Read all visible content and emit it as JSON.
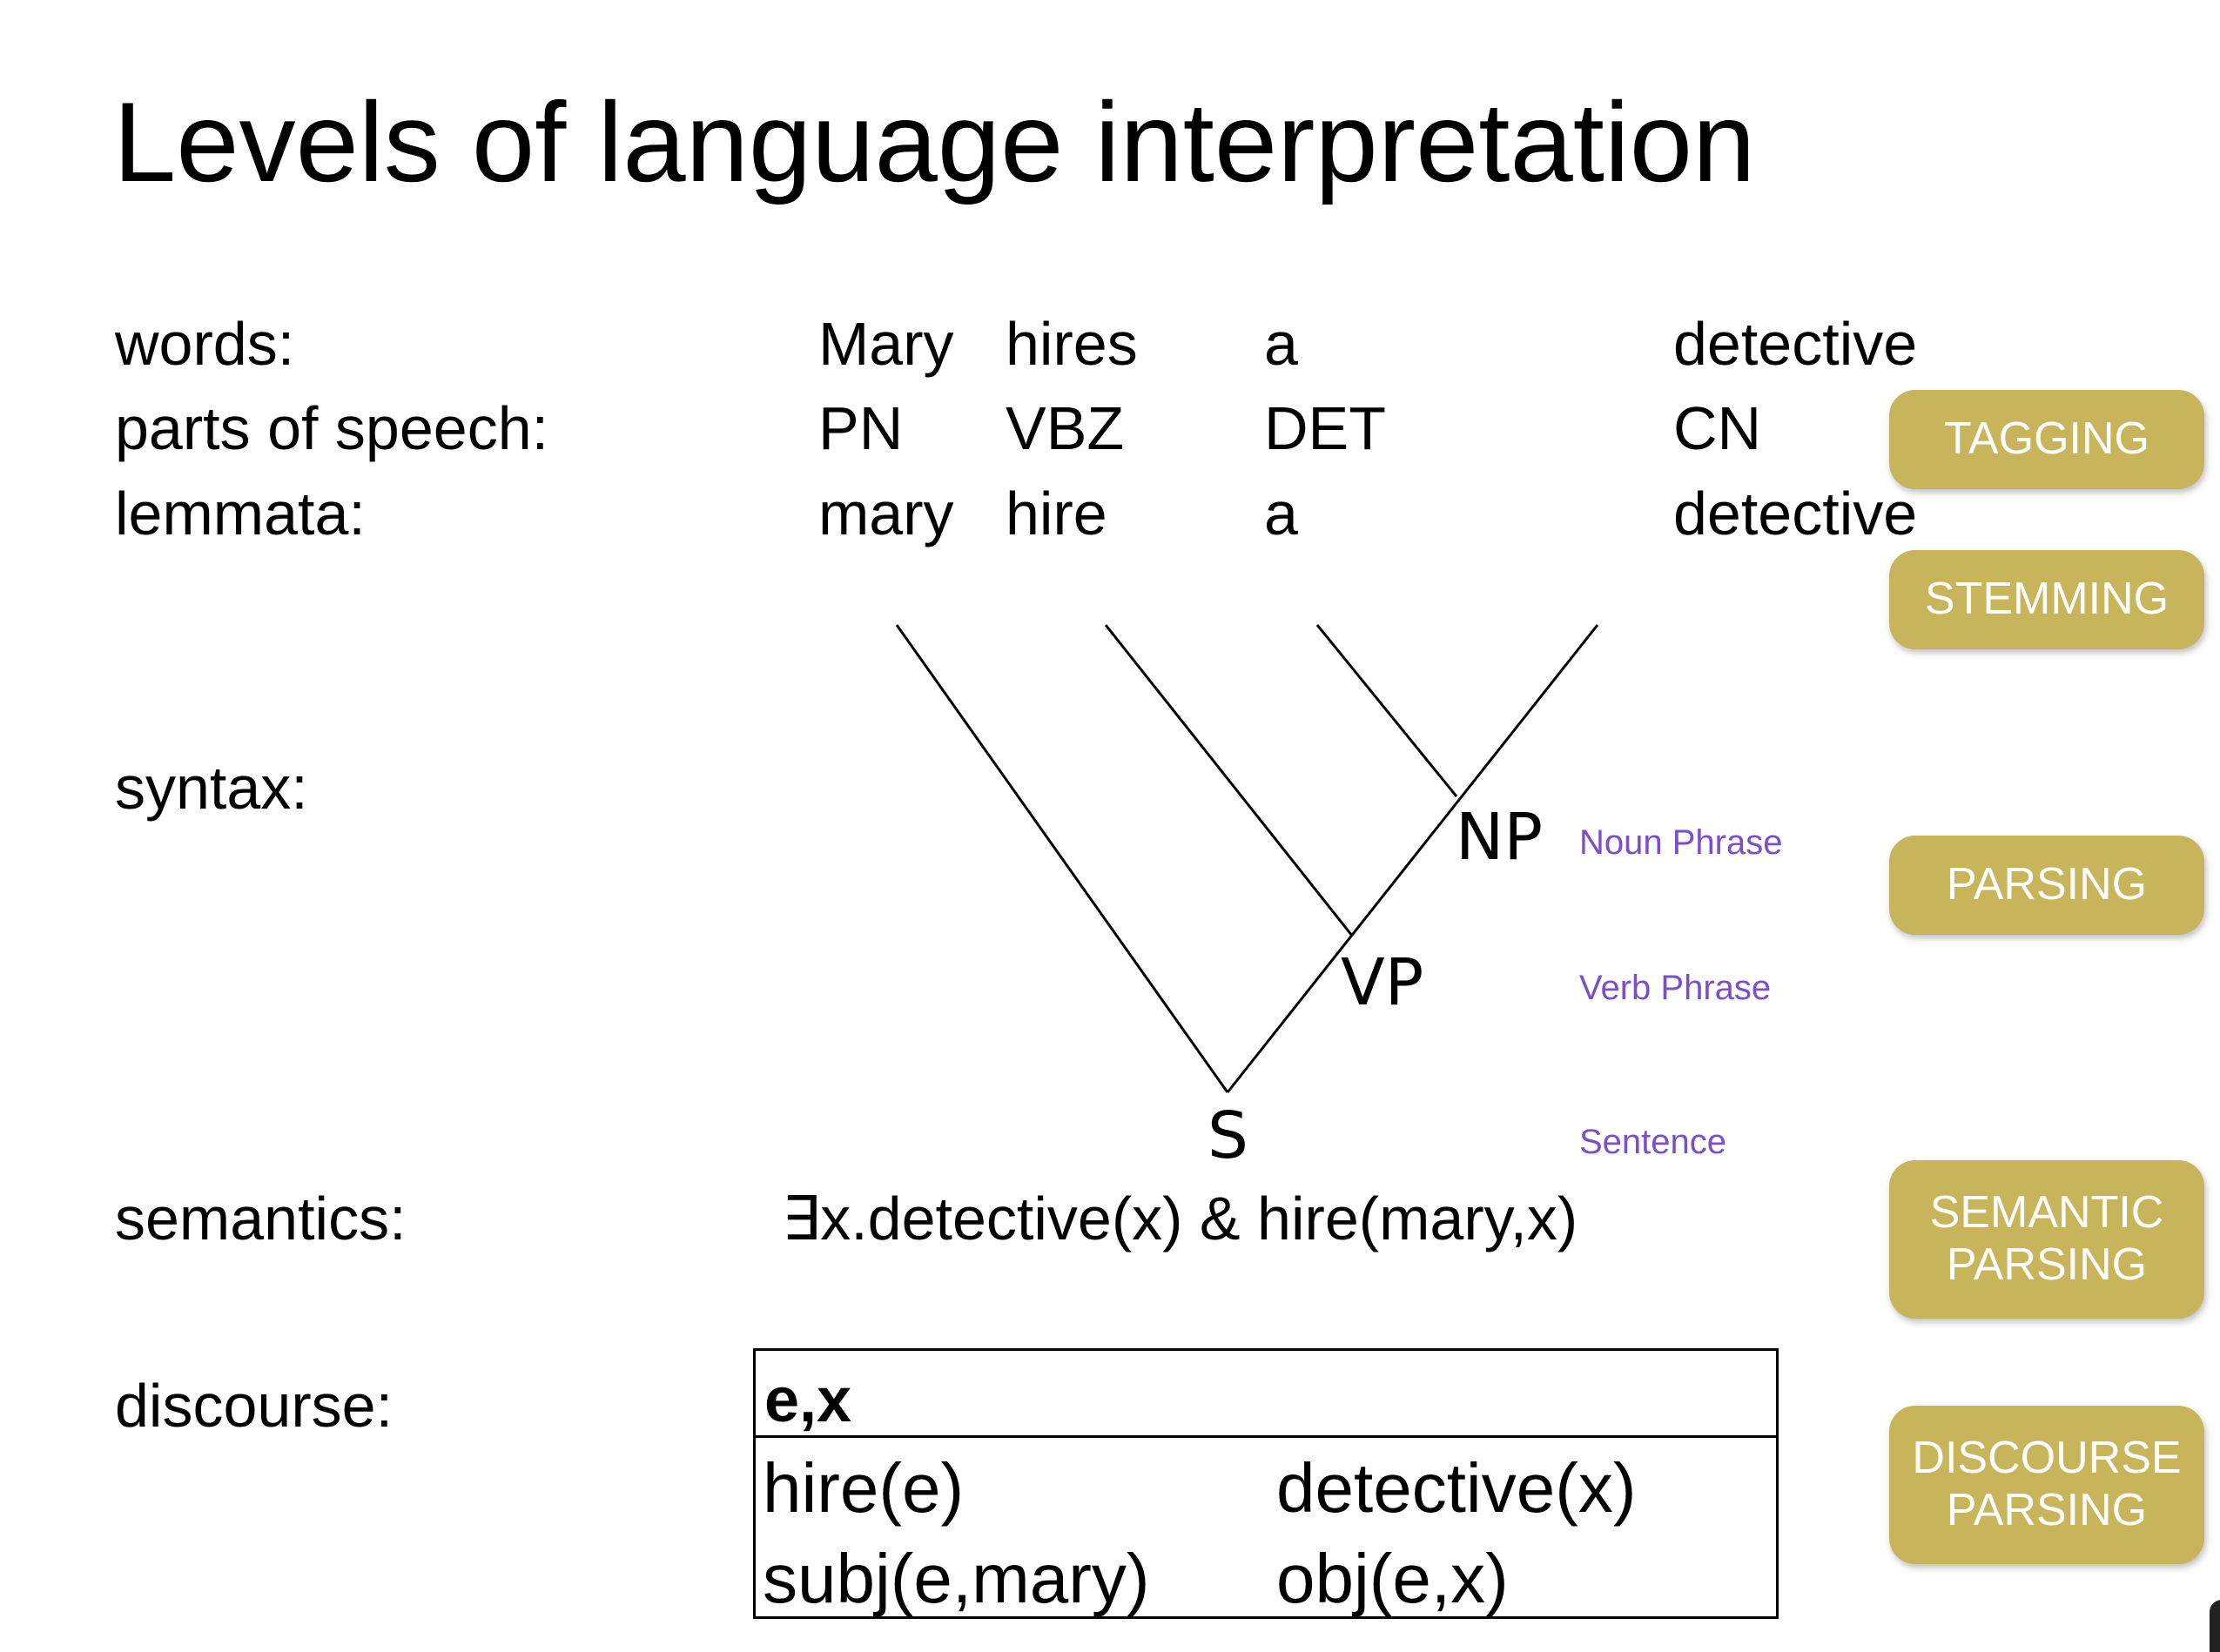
{
  "title": "Levels of language interpretation",
  "levels": {
    "words": "words:",
    "pos": "parts of speech:",
    "lemmata": "lemmata:",
    "syntax": "syntax:",
    "semantics": "semantics:",
    "discourse": "discourse:"
  },
  "tokens": [
    {
      "word": "Mary",
      "pos": "PN",
      "lemma": "mary"
    },
    {
      "word": "hires",
      "pos": "VBZ",
      "lemma": "hire"
    },
    {
      "word": "a",
      "pos": "DET",
      "lemma": "a"
    },
    {
      "word": "detective",
      "pos": "CN",
      "lemma": "detective"
    }
  ],
  "tree": {
    "nodes": {
      "np": "NP",
      "vp": "VP",
      "s": "S"
    },
    "annotations": {
      "np": "Noun Phrase",
      "vp": "Verb Phrase",
      "s": "Sentence"
    }
  },
  "semantics_formula": "∃x.detective(x) & hire(mary,x)",
  "drs": {
    "referents": "e,x",
    "conditions": [
      "hire(e)",
      "detective(x)",
      "subj(e,mary)",
      "obj(e,x)"
    ]
  },
  "processes": {
    "tagging": "TAGGING",
    "stemming": "STEMMING",
    "parsing": "PARSING",
    "semantic_parsing": "SEMANTIC\nPARSING",
    "discourse_parsing": "DISCOURSE\nPARSING"
  },
  "colors": {
    "process_button": "#c8b45a",
    "annotation": "#7b4fc9"
  }
}
